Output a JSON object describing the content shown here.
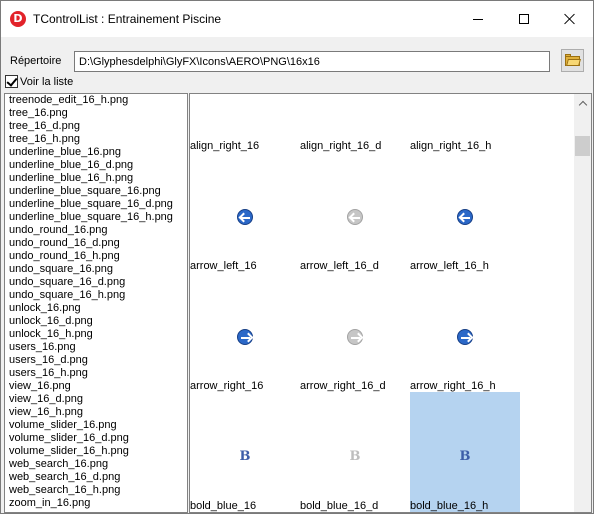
{
  "window": {
    "title": "TControlList : Entrainement Piscine",
    "app_icon_letter": "D"
  },
  "directory": {
    "label": "Répertoire",
    "value": "D:\\Glyphesdelphi\\GlyFX\\Icons\\AERO\\PNG\\16x16"
  },
  "show_list": {
    "label": "Voir la liste",
    "checked": true
  },
  "file_list": [
    "treenode_edit_16_h.png",
    "tree_16.png",
    "tree_16_d.png",
    "tree_16_h.png",
    "underline_blue_16.png",
    "underline_blue_16_d.png",
    "underline_blue_16_h.png",
    "underline_blue_square_16.png",
    "underline_blue_square_16_d.png",
    "underline_blue_square_16_h.png",
    "undo_round_16.png",
    "undo_round_16_d.png",
    "undo_round_16_h.png",
    "undo_square_16.png",
    "undo_square_16_d.png",
    "undo_square_16_h.png",
    "unlock_16.png",
    "unlock_16_d.png",
    "unlock_16_h.png",
    "users_16.png",
    "users_16_d.png",
    "users_16_h.png",
    "view_16.png",
    "view_16_d.png",
    "view_16_h.png",
    "volume_slider_16.png",
    "volume_slider_16_d.png",
    "volume_slider_16_h.png",
    "web_search_16.png",
    "web_search_16_d.png",
    "web_search_16_h.png",
    "zoom_in_16.png"
  ],
  "preview": {
    "top_labels": [
      "align_right_16",
      "align_right_16_d",
      "align_right_16_h"
    ],
    "rows": [
      {
        "cells": [
          {
            "label": "arrow_left_16",
            "icon": "arrow-left-icon",
            "state": "normal"
          },
          {
            "label": "arrow_left_16_d",
            "icon": "arrow-left-icon",
            "state": "disabled"
          },
          {
            "label": "arrow_left_16_h",
            "icon": "arrow-left-icon",
            "state": "hot"
          }
        ]
      },
      {
        "cells": [
          {
            "label": "arrow_right_16",
            "icon": "arrow-right-icon",
            "state": "normal"
          },
          {
            "label": "arrow_right_16_d",
            "icon": "arrow-right-icon",
            "state": "disabled"
          },
          {
            "label": "arrow_right_16_h",
            "icon": "arrow-right-icon",
            "state": "hot"
          }
        ]
      },
      {
        "cells": [
          {
            "label": "bold_blue_16",
            "icon": "bold-icon",
            "glyph": "B",
            "state": "normal"
          },
          {
            "label": "bold_blue_16_d",
            "icon": "bold-icon",
            "glyph": "B",
            "state": "disabled"
          },
          {
            "label": "bold_blue_16_h",
            "icon": "bold-icon",
            "glyph": "B",
            "state": "hot",
            "selected": true
          }
        ]
      }
    ]
  },
  "colors": {
    "selection": "#b5d3f0",
    "icon_blue": "#2b68c8",
    "icon_disabled": "#c6c6c6",
    "app_icon": "#e2232a"
  }
}
